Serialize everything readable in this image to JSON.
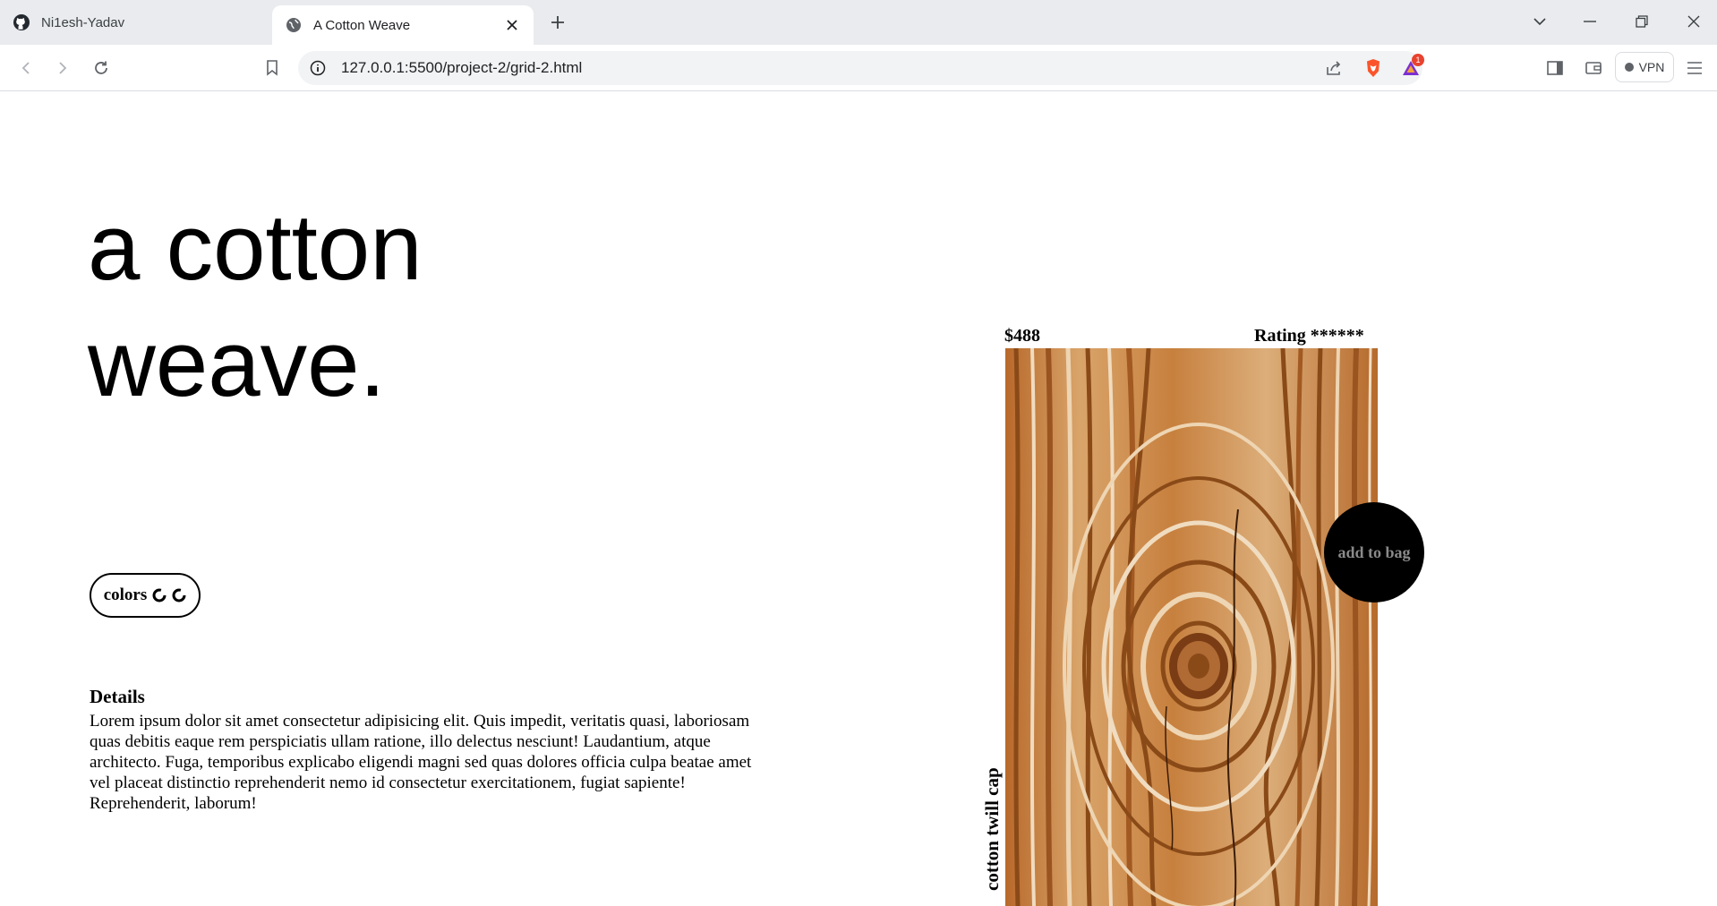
{
  "browser": {
    "tabs": [
      {
        "title": "Ni1esh-Yadav",
        "icon": "github-icon",
        "active": false
      },
      {
        "title": "A Cotton Weave",
        "icon": "globe-icon",
        "active": true
      }
    ],
    "url": "127.0.0.1:5500/project-2/grid-2.html",
    "rewards_badge": "1",
    "vpn_label": "VPN"
  },
  "page": {
    "hero_line1": "a cotton",
    "hero_line2": "weave.",
    "colors_label": "colors",
    "details_title": "Details",
    "details_text": "Lorem ipsum dolor sit amet consectetur adipisicing elit. Quis impedit, veritatis quasi, laboriosam quas debitis eaque rem perspiciatis ullam ratione, illo delectus nesciunt! Laudantium, atque architecto. Fuga, temporibus explicabo eligendi magni sed quas dolores officia culpa beatae amet vel placeat distinctio reprehenderit nemo id consectetur exercitationem, fugiat sapiente! Reprehenderit, laborum!",
    "price": "$488",
    "rating": "Rating ******",
    "product_name": "cotton twill cap",
    "add_to_bag": "add to bag"
  },
  "colors": {
    "wood_light": "#e9c9a0",
    "wood_mid": "#c57a34",
    "wood_dark": "#8a4a18",
    "button_bg": "#000000",
    "button_text": "#8a8a8a"
  }
}
